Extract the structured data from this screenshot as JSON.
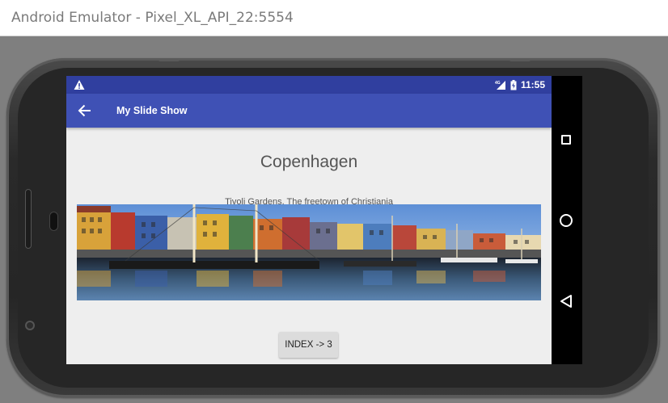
{
  "window": {
    "title": "Android Emulator - Pixel_XL_API_22:5554"
  },
  "status_bar": {
    "warning_icon": "warning-triangle-icon",
    "network": "4G",
    "time": "11:55"
  },
  "toolbar": {
    "back_icon": "arrow-left-icon",
    "title": "My Slide Show"
  },
  "slide": {
    "heading": "Copenhagen",
    "caption": "Tivoli Gardens, The freetown of Christiania",
    "image": "nyhavn-harbor-photo"
  },
  "button": {
    "label": "INDEX -> 3"
  },
  "nav_bar": {
    "recent_icon": "square-icon",
    "home_icon": "circle-icon",
    "back_icon": "triangle-back-icon"
  },
  "colors": {
    "status_bar": "#303f9f",
    "toolbar": "#3f51b5",
    "screen_bg": "#eeeeee"
  }
}
